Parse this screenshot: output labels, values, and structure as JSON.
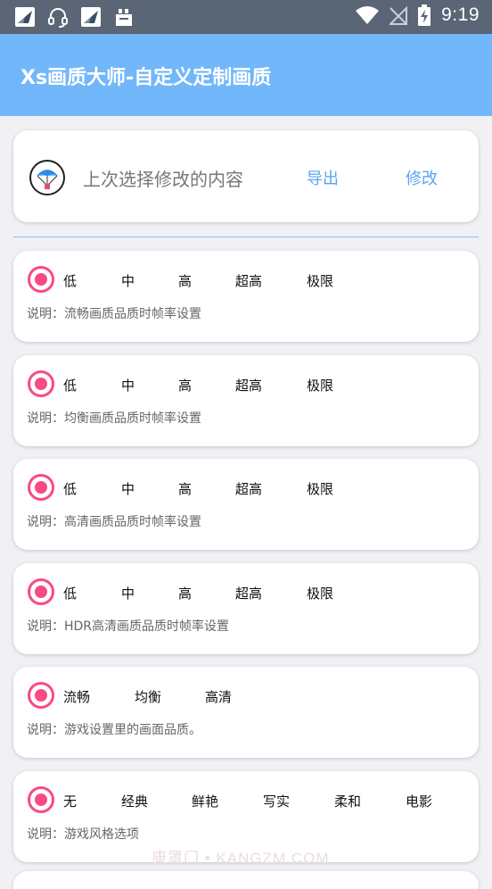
{
  "status_bar": {
    "time": "9:19",
    "left_icons": [
      "app-notification-icon",
      "headset-icon",
      "app-notification-icon",
      "bag-icon"
    ],
    "right_icons": [
      "wifi-icon",
      "no-signal-icon",
      "battery-charging-icon"
    ]
  },
  "app_bar": {
    "title": "Xs画质大师-自定义定制画质"
  },
  "header_card": {
    "hint": "上次选择修改的内容",
    "export_label": "导出",
    "modify_label": "修改",
    "logo_icon": "parachute-icon"
  },
  "settings": [
    {
      "options": [
        "低",
        "中",
        "高",
        "超高",
        "极限"
      ],
      "description": "说明：流畅画质品质时帧率设置"
    },
    {
      "options": [
        "低",
        "中",
        "高",
        "超高",
        "极限"
      ],
      "description": "说明：均衡画质品质时帧率设置"
    },
    {
      "options": [
        "低",
        "中",
        "高",
        "超高",
        "极限"
      ],
      "description": "说明：高清画质品质时帧率设置"
    },
    {
      "options": [
        "低",
        "中",
        "高",
        "超高",
        "极限"
      ],
      "description": "说明：HDR高清画质品质时帧率设置"
    },
    {
      "options": [
        "流畅",
        "均衡",
        "高清"
      ],
      "description": "说明：游戏设置里的画面品质。"
    },
    {
      "options": [
        "无",
        "经典",
        "鲜艳",
        "写实",
        "柔和",
        "电影"
      ],
      "description": "说明：游戏风格选项"
    }
  ],
  "watermark": "康罩门 • KANGZM.COM",
  "colors": {
    "app_bar": "#72b7f9",
    "accent": "#fa4a82",
    "link": "#5aa4ef",
    "status_bar": "#5a6675"
  }
}
